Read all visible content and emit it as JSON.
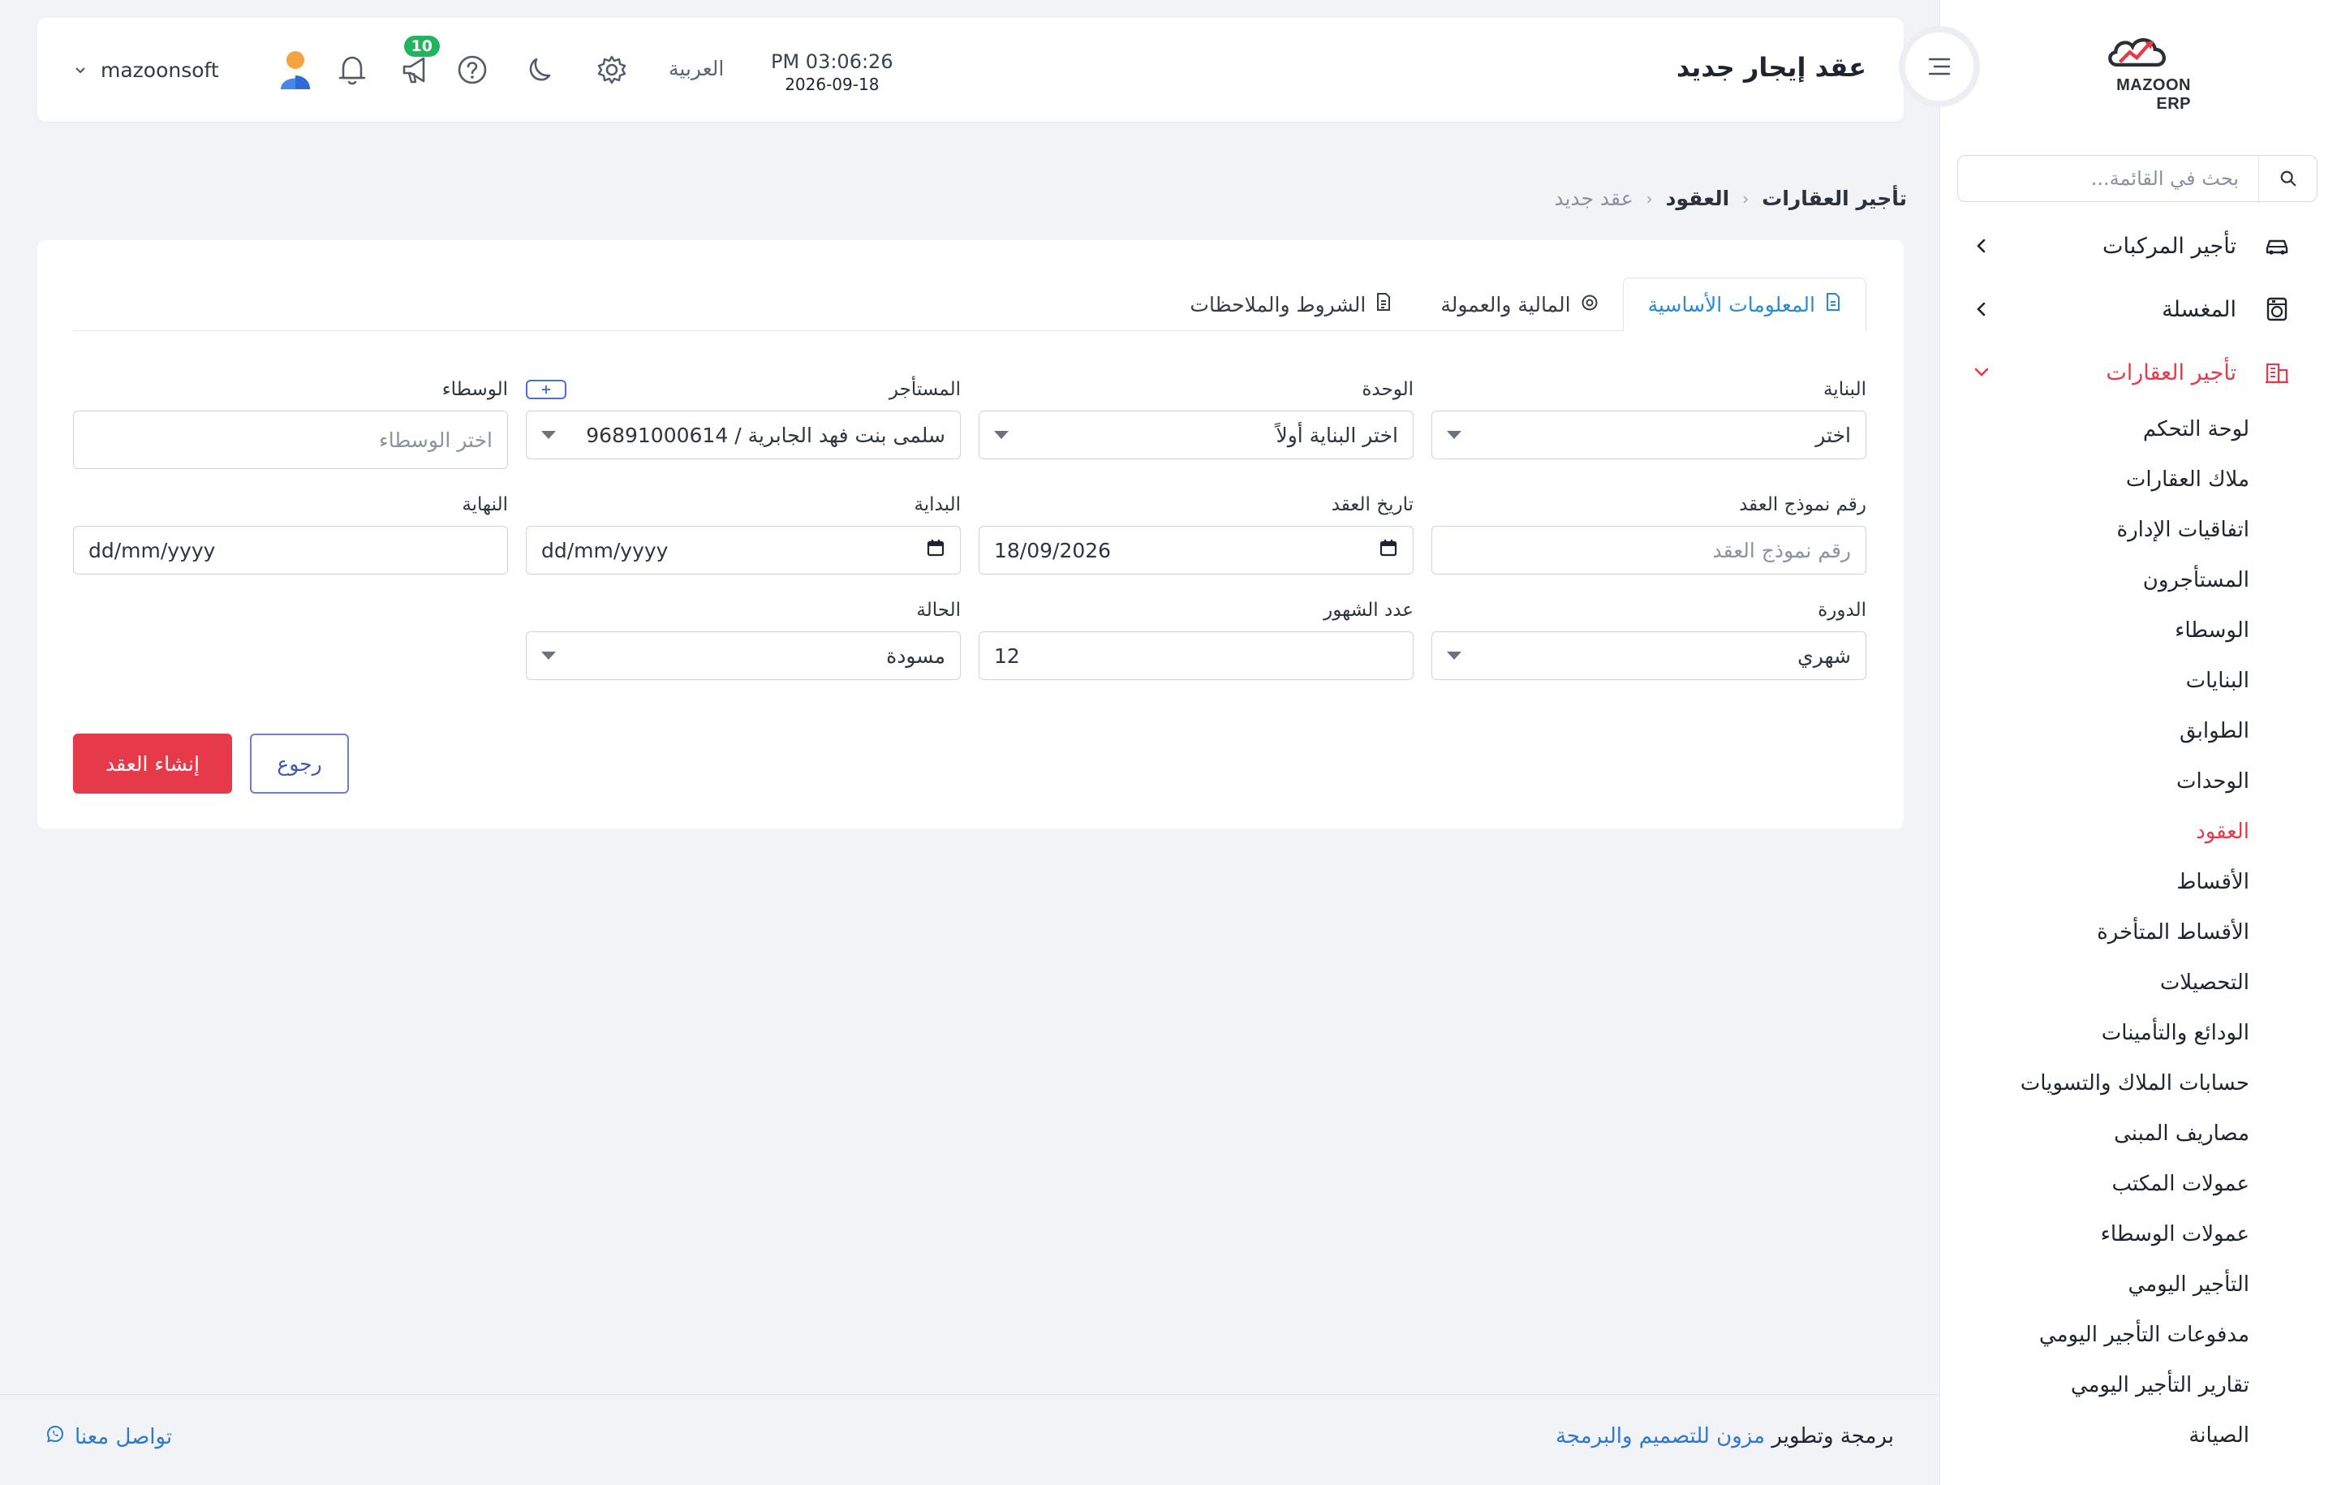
{
  "app": {
    "logo_text": "MAZOON ERP"
  },
  "header": {
    "page_title": "عقد إيجار جديد",
    "user_name": "mazoonsoft",
    "notification_count": "10",
    "language": "العربية",
    "time": "PM 03:06:26",
    "date": "2026-09-18"
  },
  "sidebar": {
    "search_placeholder": "بحث في القائمة...",
    "groups": [
      {
        "label": "تأجير المركبات",
        "icon": "car-icon"
      },
      {
        "label": "المغسلة",
        "icon": "washer-icon"
      },
      {
        "label": "تأجير العقارات",
        "icon": "building-icon"
      }
    ],
    "sub_items": [
      "لوحة التحكم",
      "ملاك العقارات",
      "اتفاقيات الإدارة",
      "المستأجرون",
      "الوسطاء",
      "البنايات",
      "الطوابق",
      "الوحدات",
      "العقود",
      "الأقساط",
      "الأقساط المتأخرة",
      "التحصيلات",
      "الودائع والتأمينات",
      "حسابات الملاك والتسويات",
      "مصاريف المبنى",
      "عمولات المكتب",
      "عمولات الوسطاء",
      "التأجير اليومي",
      "مدفوعات التأجير اليومي",
      "تقارير التأجير اليومي",
      "الصيانة"
    ]
  },
  "breadcrumb": {
    "root": "تأجير العقارات",
    "section": "العقود",
    "current": "عقد جديد"
  },
  "tabs": [
    {
      "label": "المعلومات الأساسية",
      "icon": "document-icon"
    },
    {
      "label": "المالية والعمولة",
      "icon": "coin-icon"
    },
    {
      "label": "الشروط والملاحظات",
      "icon": "file-text-icon"
    }
  ],
  "form": {
    "building": {
      "label": "البناية",
      "value": "اختر"
    },
    "unit": {
      "label": "الوحدة",
      "value": "اختر البناية أولاً"
    },
    "tenant": {
      "label": "المستأجر",
      "value": "سلمى بنت فهد الجابرية / 96891000614"
    },
    "brokers": {
      "label": "الوسطاء",
      "placeholder": "اختر الوسطاء"
    },
    "contract_template_no": {
      "label": "رقم نموذج العقد",
      "placeholder": "رقم نموذج العقد"
    },
    "contract_date": {
      "label": "تاريخ العقد",
      "value": "18/09/2026"
    },
    "start_date": {
      "label": "البداية",
      "value": "dd/mm/yyyy"
    },
    "end_date": {
      "label": "النهاية",
      "value": "dd/mm/yyyy"
    },
    "cycle": {
      "label": "الدورة",
      "value": "شهري"
    },
    "months": {
      "label": "عدد الشهور",
      "value": "12"
    },
    "status": {
      "label": "الحالة",
      "value": "مسودة"
    }
  },
  "actions": {
    "create": "إنشاء العقد",
    "back": "رجوع"
  },
  "footer": {
    "prefix": "برمجة وتطوير",
    "company_link": "مزون للتصميم والبرمجة",
    "contact": "تواصل معنا"
  },
  "colors": {
    "accent_red": "#e63a4b",
    "accent_blue": "#2a8ad4",
    "badge_green": "#22b35e"
  }
}
